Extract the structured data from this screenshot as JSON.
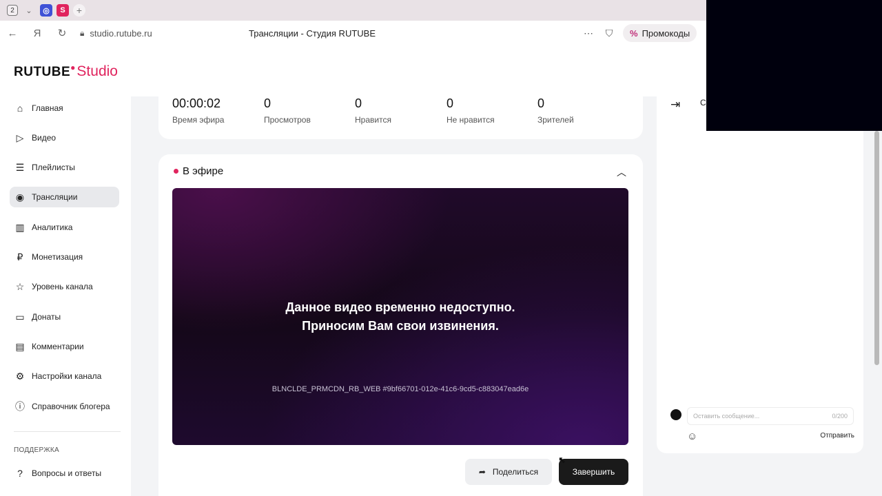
{
  "browser": {
    "tab_count": "2",
    "url": "studio.rutube.ru",
    "page_title": "Трансляции - Студия RUTUBE",
    "promo_label": "Промокоды"
  },
  "app": {
    "logo_main": "RUTUBE",
    "logo_sub": "Studio",
    "brand_color": "#e0245e"
  },
  "sidebar": {
    "items": [
      {
        "label": "Главная",
        "icon": "home-icon"
      },
      {
        "label": "Видео",
        "icon": "video-icon"
      },
      {
        "label": "Плейлисты",
        "icon": "playlist-icon"
      },
      {
        "label": "Трансляции",
        "icon": "broadcast-icon",
        "active": true
      },
      {
        "label": "Аналитика",
        "icon": "analytics-icon"
      },
      {
        "label": "Монетизация",
        "icon": "ruble-icon"
      },
      {
        "label": "Уровень канала",
        "icon": "star-icon"
      },
      {
        "label": "Донаты",
        "icon": "wallet-icon"
      },
      {
        "label": "Комментарии",
        "icon": "comment-icon"
      },
      {
        "label": "Настройки канала",
        "icon": "gear-icon"
      },
      {
        "label": "Справочник блогера",
        "icon": "info-icon"
      }
    ],
    "support_heading": "ПОДДЕРЖКА",
    "support_items": [
      {
        "label": "Вопросы и ответы",
        "icon": "question-icon"
      }
    ]
  },
  "stats": [
    {
      "value": "00:00:02",
      "label": "Время эфира"
    },
    {
      "value": "0",
      "label": "Просмотров"
    },
    {
      "value": "0",
      "label": "Нравится"
    },
    {
      "value": "0",
      "label": "Не нравится"
    },
    {
      "value": "0",
      "label": "Зрителей"
    }
  ],
  "live": {
    "title": "В эфире",
    "message_line1": "Данное видео временно недоступно.",
    "message_line2": "Приносим Вам свои извинения.",
    "error_code": "BLNCLDE_PRMCDN_RB_WEB #9bf66701-012e-41c6-9cd5-c883047ead6e",
    "share_label": "Поделиться",
    "finish_label": "Завершить"
  },
  "chat": {
    "tab_label": "Cc",
    "input_placeholder": "Оставить сообщение...",
    "char_counter": "0/200",
    "send_label": "Отправить"
  }
}
